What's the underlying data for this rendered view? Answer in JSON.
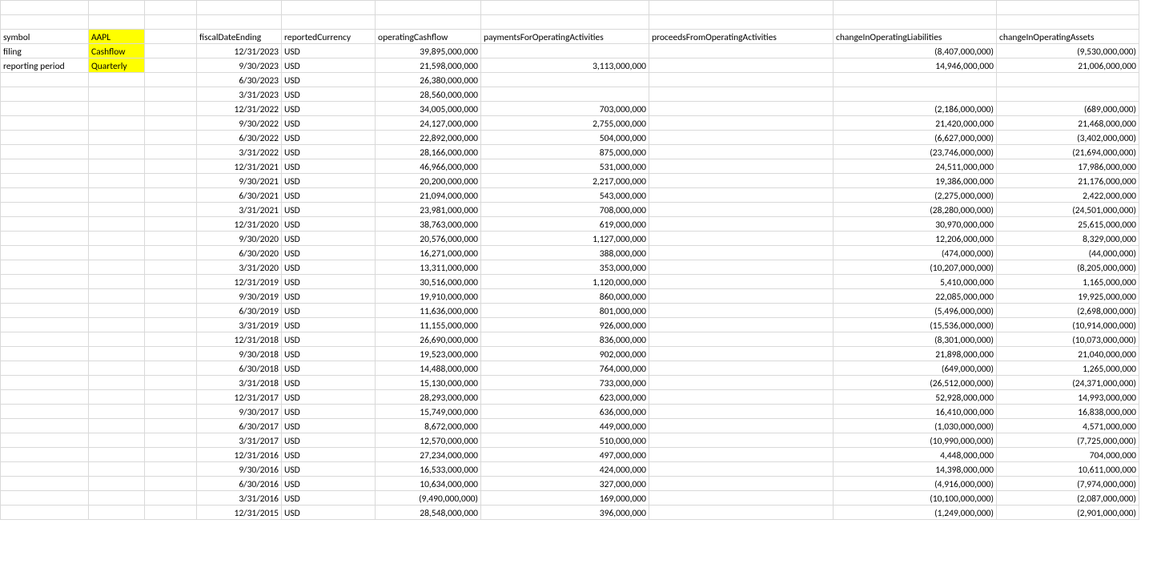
{
  "meta": {
    "labels": {
      "symbol": "symbol",
      "filing": "filing",
      "period": "reporting period"
    },
    "values": {
      "symbol": "AAPL",
      "filing": "Cashflow",
      "period": "Quarterly"
    }
  },
  "headers": {
    "fiscalDateEnding": "fiscalDateEnding",
    "reportedCurrency": "reportedCurrency",
    "operatingCashflow": "operatingCashflow",
    "paymentsForOperatingActivities": "paymentsForOperatingActivities",
    "proceedsFromOperatingActivities": "proceedsFromOperatingActivities",
    "changeInOperatingLiabilities": "changeInOperatingLiabilities",
    "changeInOperatingAssets": "changeInOperatingAssets"
  },
  "rows": [
    {
      "date": "12/31/2023",
      "cur": "USD",
      "op": "39,895,000,000",
      "pay": "",
      "proc": "",
      "liab": "(8,407,000,000)",
      "assets": "(9,530,000,000)"
    },
    {
      "date": "9/30/2023",
      "cur": "USD",
      "op": "21,598,000,000",
      "pay": "3,113,000,000",
      "proc": "",
      "liab": "14,946,000,000",
      "assets": "21,006,000,000"
    },
    {
      "date": "6/30/2023",
      "cur": "USD",
      "op": "26,380,000,000",
      "pay": "",
      "proc": "",
      "liab": "",
      "assets": ""
    },
    {
      "date": "3/31/2023",
      "cur": "USD",
      "op": "28,560,000,000",
      "pay": "",
      "proc": "",
      "liab": "",
      "assets": ""
    },
    {
      "date": "12/31/2022",
      "cur": "USD",
      "op": "34,005,000,000",
      "pay": "703,000,000",
      "proc": "",
      "liab": "(2,186,000,000)",
      "assets": "(689,000,000)"
    },
    {
      "date": "9/30/2022",
      "cur": "USD",
      "op": "24,127,000,000",
      "pay": "2,755,000,000",
      "proc": "",
      "liab": "21,420,000,000",
      "assets": "21,468,000,000"
    },
    {
      "date": "6/30/2022",
      "cur": "USD",
      "op": "22,892,000,000",
      "pay": "504,000,000",
      "proc": "",
      "liab": "(6,627,000,000)",
      "assets": "(3,402,000,000)"
    },
    {
      "date": "3/31/2022",
      "cur": "USD",
      "op": "28,166,000,000",
      "pay": "875,000,000",
      "proc": "",
      "liab": "(23,746,000,000)",
      "assets": "(21,694,000,000)"
    },
    {
      "date": "12/31/2021",
      "cur": "USD",
      "op": "46,966,000,000",
      "pay": "531,000,000",
      "proc": "",
      "liab": "24,511,000,000",
      "assets": "17,986,000,000"
    },
    {
      "date": "9/30/2021",
      "cur": "USD",
      "op": "20,200,000,000",
      "pay": "2,217,000,000",
      "proc": "",
      "liab": "19,386,000,000",
      "assets": "21,176,000,000"
    },
    {
      "date": "6/30/2021",
      "cur": "USD",
      "op": "21,094,000,000",
      "pay": "543,000,000",
      "proc": "",
      "liab": "(2,275,000,000)",
      "assets": "2,422,000,000"
    },
    {
      "date": "3/31/2021",
      "cur": "USD",
      "op": "23,981,000,000",
      "pay": "708,000,000",
      "proc": "",
      "liab": "(28,280,000,000)",
      "assets": "(24,501,000,000)"
    },
    {
      "date": "12/31/2020",
      "cur": "USD",
      "op": "38,763,000,000",
      "pay": "619,000,000",
      "proc": "",
      "liab": "30,970,000,000",
      "assets": "25,615,000,000"
    },
    {
      "date": "9/30/2020",
      "cur": "USD",
      "op": "20,576,000,000",
      "pay": "1,127,000,000",
      "proc": "",
      "liab": "12,206,000,000",
      "assets": "8,329,000,000"
    },
    {
      "date": "6/30/2020",
      "cur": "USD",
      "op": "16,271,000,000",
      "pay": "388,000,000",
      "proc": "",
      "liab": "(474,000,000)",
      "assets": "(44,000,000)"
    },
    {
      "date": "3/31/2020",
      "cur": "USD",
      "op": "13,311,000,000",
      "pay": "353,000,000",
      "proc": "",
      "liab": "(10,207,000,000)",
      "assets": "(8,205,000,000)"
    },
    {
      "date": "12/31/2019",
      "cur": "USD",
      "op": "30,516,000,000",
      "pay": "1,120,000,000",
      "proc": "",
      "liab": "5,410,000,000",
      "assets": "1,165,000,000"
    },
    {
      "date": "9/30/2019",
      "cur": "USD",
      "op": "19,910,000,000",
      "pay": "860,000,000",
      "proc": "",
      "liab": "22,085,000,000",
      "assets": "19,925,000,000"
    },
    {
      "date": "6/30/2019",
      "cur": "USD",
      "op": "11,636,000,000",
      "pay": "801,000,000",
      "proc": "",
      "liab": "(5,496,000,000)",
      "assets": "(2,698,000,000)"
    },
    {
      "date": "3/31/2019",
      "cur": "USD",
      "op": "11,155,000,000",
      "pay": "926,000,000",
      "proc": "",
      "liab": "(15,536,000,000)",
      "assets": "(10,914,000,000)"
    },
    {
      "date": "12/31/2018",
      "cur": "USD",
      "op": "26,690,000,000",
      "pay": "836,000,000",
      "proc": "",
      "liab": "(8,301,000,000)",
      "assets": "(10,073,000,000)"
    },
    {
      "date": "9/30/2018",
      "cur": "USD",
      "op": "19,523,000,000",
      "pay": "902,000,000",
      "proc": "",
      "liab": "21,898,000,000",
      "assets": "21,040,000,000"
    },
    {
      "date": "6/30/2018",
      "cur": "USD",
      "op": "14,488,000,000",
      "pay": "764,000,000",
      "proc": "",
      "liab": "(649,000,000)",
      "assets": "1,265,000,000"
    },
    {
      "date": "3/31/2018",
      "cur": "USD",
      "op": "15,130,000,000",
      "pay": "733,000,000",
      "proc": "",
      "liab": "(26,512,000,000)",
      "assets": "(24,371,000,000)"
    },
    {
      "date": "12/31/2017",
      "cur": "USD",
      "op": "28,293,000,000",
      "pay": "623,000,000",
      "proc": "",
      "liab": "52,928,000,000",
      "assets": "14,993,000,000"
    },
    {
      "date": "9/30/2017",
      "cur": "USD",
      "op": "15,749,000,000",
      "pay": "636,000,000",
      "proc": "",
      "liab": "16,410,000,000",
      "assets": "16,838,000,000"
    },
    {
      "date": "6/30/2017",
      "cur": "USD",
      "op": "8,672,000,000",
      "pay": "449,000,000",
      "proc": "",
      "liab": "(1,030,000,000)",
      "assets": "4,571,000,000"
    },
    {
      "date": "3/31/2017",
      "cur": "USD",
      "op": "12,570,000,000",
      "pay": "510,000,000",
      "proc": "",
      "liab": "(10,990,000,000)",
      "assets": "(7,725,000,000)"
    },
    {
      "date": "12/31/2016",
      "cur": "USD",
      "op": "27,234,000,000",
      "pay": "497,000,000",
      "proc": "",
      "liab": "4,448,000,000",
      "assets": "704,000,000"
    },
    {
      "date": "9/30/2016",
      "cur": "USD",
      "op": "16,533,000,000",
      "pay": "424,000,000",
      "proc": "",
      "liab": "14,398,000,000",
      "assets": "10,611,000,000"
    },
    {
      "date": "6/30/2016",
      "cur": "USD",
      "op": "10,634,000,000",
      "pay": "327,000,000",
      "proc": "",
      "liab": "(4,916,000,000)",
      "assets": "(7,974,000,000)"
    },
    {
      "date": "3/31/2016",
      "cur": "USD",
      "op": "(9,490,000,000)",
      "pay": "169,000,000",
      "proc": "",
      "liab": "(10,100,000,000)",
      "assets": "(2,087,000,000)"
    },
    {
      "date": "12/31/2015",
      "cur": "USD",
      "op": "28,548,000,000",
      "pay": "396,000,000",
      "proc": "",
      "liab": "(1,249,000,000)",
      "assets": "(2,901,000,000)"
    }
  ]
}
